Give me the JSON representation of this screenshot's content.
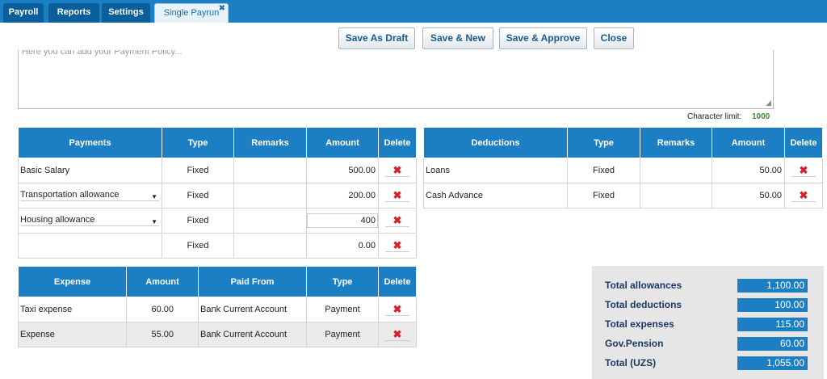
{
  "tabs": [
    {
      "label": "Payroll"
    },
    {
      "label": "Reports"
    },
    {
      "label": "Settings"
    },
    {
      "label": "Single Payrun",
      "close": "✖"
    }
  ],
  "actions": {
    "save_draft": "Save As Draft",
    "save_new": "Save & New",
    "save_approve": "Save & Approve",
    "close": "Close"
  },
  "policy": {
    "placeholder": "Here you can add your Payment Policy...",
    "char_limit_label": "Character limit:",
    "char_limit_value": "1000"
  },
  "payments": {
    "headers": [
      "Payments",
      "Type",
      "Remarks",
      "Amount",
      "Delete"
    ],
    "rows": [
      {
        "name": "Basic Salary",
        "type": "Fixed",
        "remarks": "",
        "amount": "500.00"
      },
      {
        "name": "Transportation allowance",
        "type": "Fixed",
        "remarks": "",
        "amount": "200.00"
      },
      {
        "name": "Housing allowance",
        "type": "Fixed",
        "remarks": "",
        "amount": "400"
      },
      {
        "name": "",
        "type": "Fixed",
        "remarks": "",
        "amount": "0.00"
      }
    ]
  },
  "deductions": {
    "headers": [
      "Deductions",
      "Type",
      "Remarks",
      "Amount",
      "Delete"
    ],
    "rows": [
      {
        "name": "Loans",
        "type": "Fixed",
        "remarks": "",
        "amount": "50.00"
      },
      {
        "name": "Cash Advance",
        "type": "Fixed",
        "remarks": "",
        "amount": "50.00"
      }
    ]
  },
  "expenses": {
    "headers": [
      "Expense",
      "Amount",
      "Paid From",
      "Type",
      "Delete"
    ],
    "rows": [
      {
        "name": "Taxi expense",
        "amount": "60.00",
        "paid_from": "Bank Current Account",
        "type": "Payment"
      },
      {
        "name": "Expense",
        "amount": "55.00",
        "paid_from": "Bank Current Account",
        "type": "Payment"
      }
    ]
  },
  "totals": [
    {
      "label": "Total allowances",
      "value": "1,100.00"
    },
    {
      "label": "Total deductions",
      "value": "100.00"
    },
    {
      "label": "Total expenses",
      "value": "115.00"
    },
    {
      "label": "Gov.Pension",
      "value": "60.00"
    },
    {
      "label": "Total (UZS)",
      "value": "1,055.00"
    }
  ],
  "icons": {
    "delete": "✖",
    "dropdown": "▼",
    "resize": "◢"
  },
  "colors": {
    "header_blue": "#1c7fc4",
    "delete_red": "#d8202a",
    "char_limit_green": "#3a8a3a"
  }
}
